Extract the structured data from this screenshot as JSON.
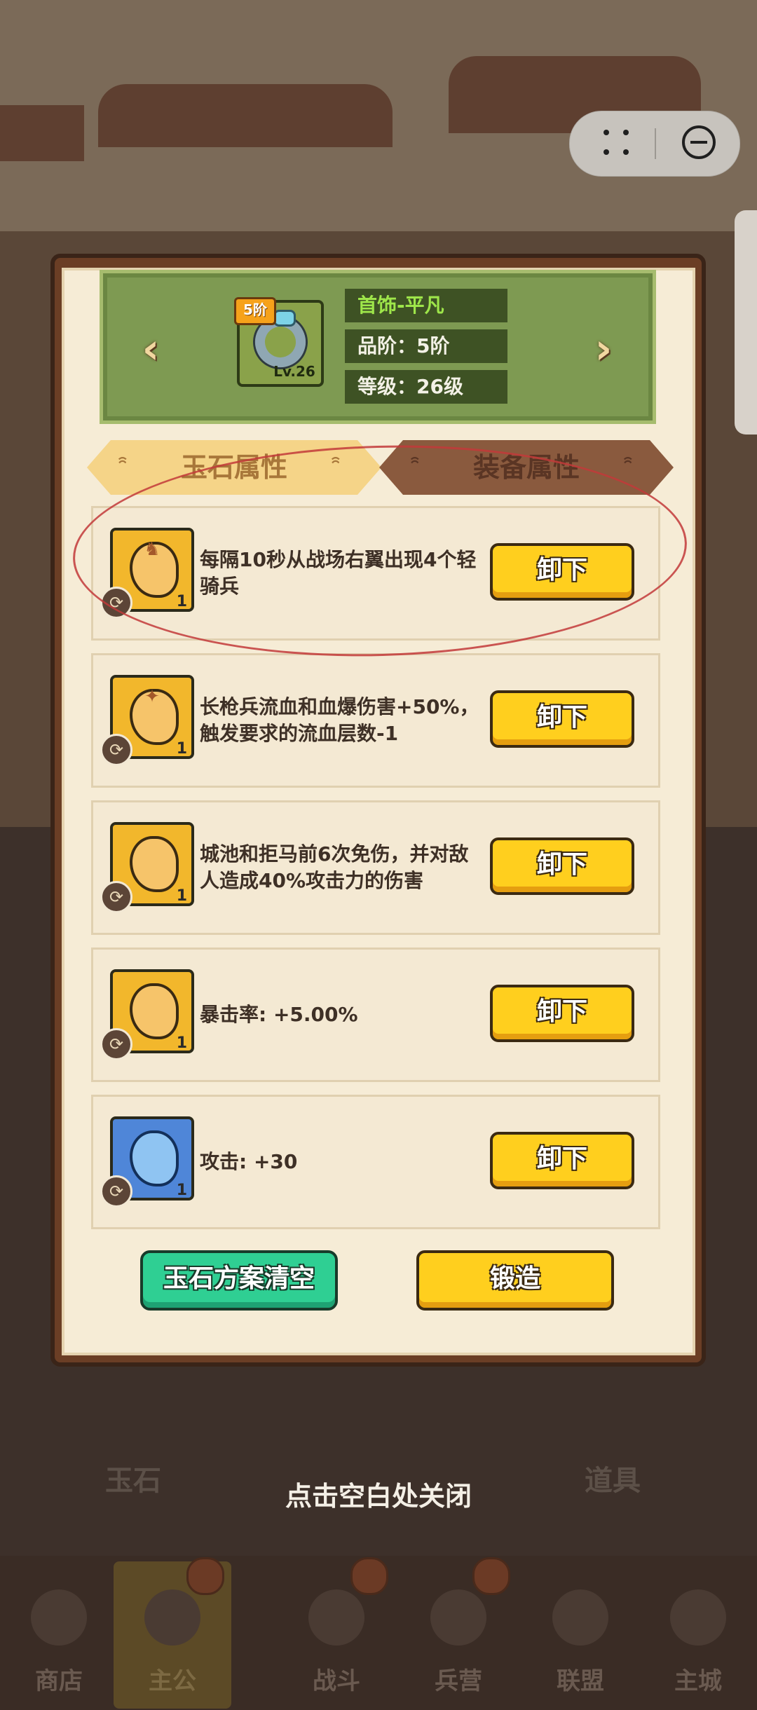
{
  "header": {
    "item_name": "首饰-平凡",
    "tier": "品阶：5阶",
    "level": "等级：26级",
    "icon_tier_badge": "5阶",
    "icon_level": "Lv.26",
    "prev_icon": "chevron-left-icon",
    "next_icon": "chevron-right-icon"
  },
  "tabs": [
    {
      "label": "玉石属性",
      "active": true
    },
    {
      "label": "装备属性",
      "active": false
    }
  ],
  "jades": [
    {
      "description": "每隔10秒从战场右翼出现4个轻骑兵",
      "count": "1",
      "color": "gold",
      "glyph": "♞",
      "button": "卸下"
    },
    {
      "description": "长枪兵流血和血爆伤害+50%，触发要求的流血层数-1",
      "count": "1",
      "color": "gold",
      "glyph": "✦",
      "button": "卸下"
    },
    {
      "description": "城池和拒马前6次免伤，并对敌人造成40%攻击力的伤害",
      "count": "1",
      "color": "gold",
      "glyph": "",
      "button": "卸下"
    },
    {
      "description": "暴击率: +5.00%",
      "count": "1",
      "color": "gold",
      "glyph": "",
      "button": "卸下"
    },
    {
      "description": "攻击:  +30",
      "count": "1",
      "color": "blue",
      "glyph": "",
      "button": "卸下"
    }
  ],
  "actions": {
    "clear_label": "玉石方案清空",
    "forge_label": "锻造"
  },
  "close_hint": "点击空白处关闭",
  "background": {
    "tabs": [
      "玉石",
      "道具"
    ],
    "bottom_nav": [
      "商店",
      "主公",
      "战斗",
      "兵营",
      "联盟",
      "主城"
    ],
    "active_nav": "主公"
  },
  "colors": {
    "accent_yellow": "#ffcf1e",
    "accent_green": "#2fcf93",
    "header_green": "#7e9a52",
    "annotation_red": "#c23a3a"
  }
}
